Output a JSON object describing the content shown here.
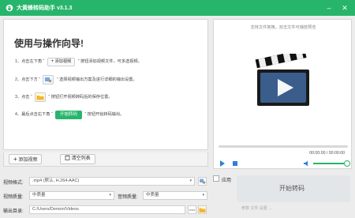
{
  "app": {
    "title": "大黄蜂转码助手 v3.1.3"
  },
  "guide": {
    "heading": "使用与操作向导!",
    "steps": [
      {
        "prefix": "1、点击左下角 “",
        "button": "添加视频",
        "suffix": "” 按钮添加视频文件，可多选视频。"
      },
      {
        "prefix": "2、点击下方 “",
        "suffix": "” 选择视频输出方案及进行详细的输出设置。"
      },
      {
        "prefix": "3、点击 “",
        "suffix": "” 按钮打开视频转码后的保存位置。"
      },
      {
        "prefix": "4、最后点击右下角 “",
        "button": "开始转码",
        "suffix": "” 按钮开始转码输出。"
      }
    ]
  },
  "buttons": {
    "add_video": "添加视频",
    "clear_list": "清空列表",
    "start": "开始转码"
  },
  "preview": {
    "hint": "支持文件拖拽，双击文件可播放预览",
    "time": "00:00:00 / 00:00:00"
  },
  "settings": {
    "format_label": "视频格式:",
    "format_value": ".mp4 (默认, H.264-AAC)",
    "quality_label": "视频质量:",
    "quality_value": "中质量",
    "audio_label": "音频质量:",
    "audio_value": "中质量",
    "output_label": "输出目录:",
    "output_value": "C:/Users/Demon/Videos",
    "apply_label": "应用",
    "partial_text": "参数 文件 设置 ..."
  },
  "colors": {
    "brand": "#27b56b",
    "accent_blue": "#2f7fd8"
  },
  "icons": {
    "logo": "bee-logo-icon",
    "minimize": "minimize-icon",
    "close": "close-icon",
    "video": "clapperboard-play-icon"
  }
}
